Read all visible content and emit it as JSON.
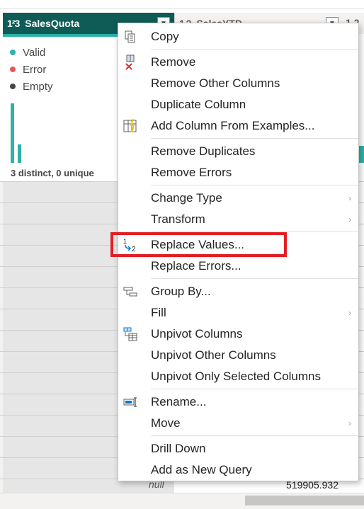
{
  "columns": {
    "active": {
      "type_glyph": "1²3",
      "name": "SalesQuota"
    },
    "next": {
      "type_glyph": "1.2",
      "name": "SalesYTD"
    },
    "cut": {
      "type_glyph": "1.2"
    }
  },
  "profile": {
    "legend": [
      {
        "label": "Valid",
        "color": "#2bb3a8"
      },
      {
        "label": "Error",
        "color": "#e8575a"
      },
      {
        "label": "Empty",
        "color": "#484644"
      }
    ],
    "bars": [
      0.96,
      0.3
    ],
    "stats": "3 distinct, 0 unique"
  },
  "bottom_row": {
    "null_text": "null",
    "value": "519905.932"
  },
  "menu": {
    "items": [
      {
        "label": "Copy",
        "icon": "copy-icon"
      },
      {
        "label": "Remove",
        "icon": "remove-icon"
      },
      {
        "label": "Remove Other Columns"
      },
      {
        "label": "Duplicate Column"
      },
      {
        "label": "Add Column From Examples...",
        "icon": "column-from-examples-icon"
      },
      {
        "label": "Remove Duplicates"
      },
      {
        "label": "Remove Errors"
      },
      {
        "label": "Change Type",
        "submenu": true
      },
      {
        "label": "Transform",
        "submenu": true
      },
      {
        "label": "Replace Values...",
        "icon": "replace-values-icon"
      },
      {
        "label": "Replace Errors..."
      },
      {
        "label": "Group By...",
        "icon": "group-by-icon"
      },
      {
        "label": "Fill",
        "submenu": true
      },
      {
        "label": "Unpivot Columns",
        "icon": "unpivot-icon"
      },
      {
        "label": "Unpivot Other Columns"
      },
      {
        "label": "Unpivot Only Selected Columns"
      },
      {
        "label": "Rename...",
        "icon": "rename-icon"
      },
      {
        "label": "Move",
        "submenu": true
      },
      {
        "label": "Drill Down"
      },
      {
        "label": "Add as New Query"
      }
    ],
    "submenu_glyph": "›"
  },
  "highlight_color": "#e31e24"
}
